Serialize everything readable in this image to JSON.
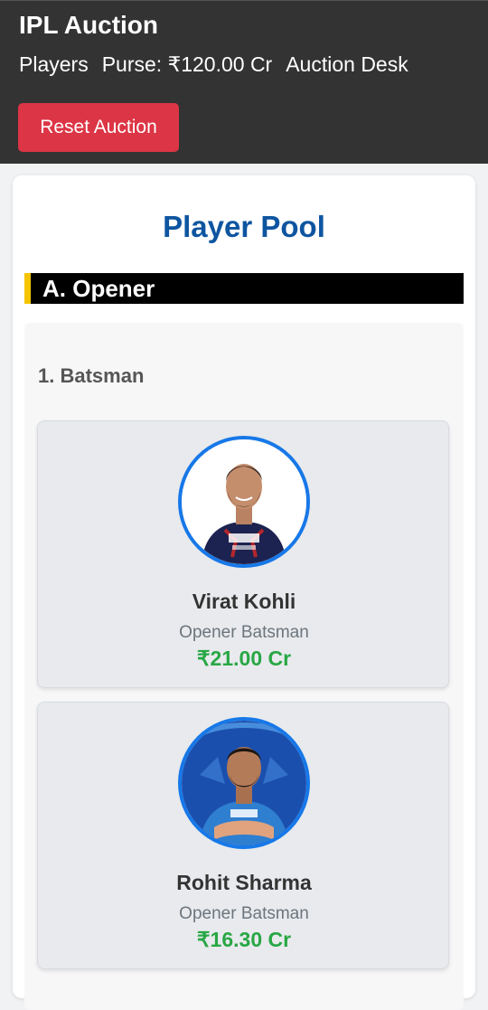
{
  "header": {
    "title": "IPL Auction",
    "nav": [
      "Players",
      "Purse: ₹120.00 Cr",
      "Auction Desk"
    ],
    "reset_label": "Reset Auction"
  },
  "pool": {
    "title": "Player Pool",
    "section": "A. Opener",
    "group_title": "1. Batsman",
    "players": [
      {
        "name": "Virat Kohli",
        "role": "Opener Batsman",
        "price": "₹21.00 Cr"
      },
      {
        "name": "Rohit Sharma",
        "role": "Opener Batsman",
        "price": "₹16.30 Cr"
      }
    ]
  },
  "colors": {
    "header_bg": "#333333",
    "reset_button": "#dc3545",
    "pool_title": "#0e55a0",
    "section_accent": "#f5c400",
    "price": "#28a745",
    "avatar_ring": "#1778e8"
  }
}
